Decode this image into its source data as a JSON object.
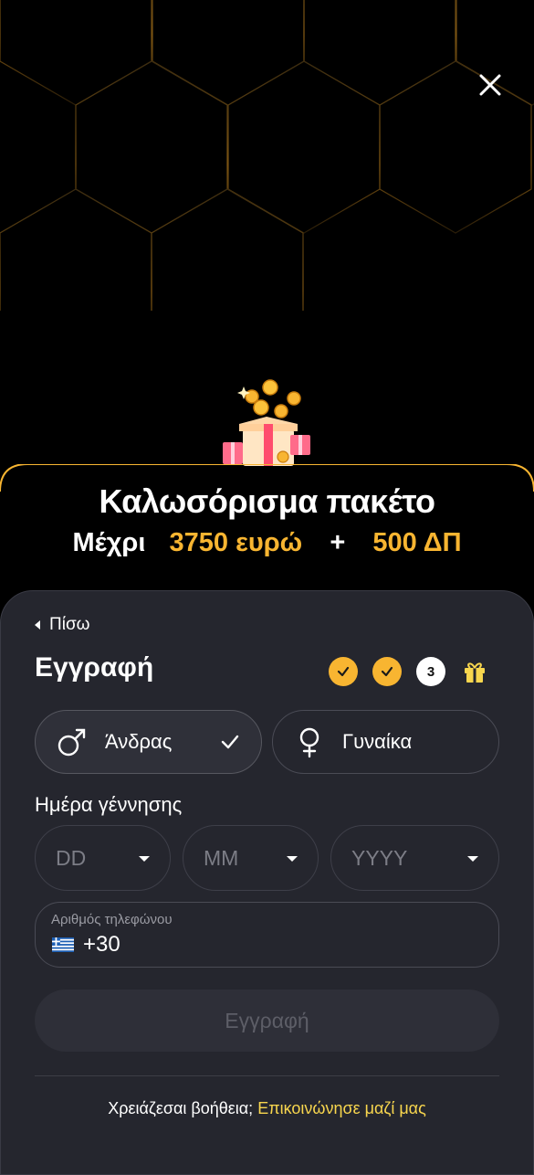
{
  "close": {
    "icon": "close-icon"
  },
  "promo": {
    "title": "Καλωσόρισμα πακέτο",
    "prefix": "Μέχρι",
    "amount": "3750 ευρώ",
    "plus": "+",
    "bonus": "500 ΔΠ"
  },
  "form": {
    "back_label": "Πίσω",
    "title": "Εγγραφή",
    "steps": [
      {
        "state": "done",
        "icon": "check-icon"
      },
      {
        "state": "done",
        "icon": "check-icon"
      },
      {
        "state": "current",
        "label": "3"
      },
      {
        "state": "reward",
        "icon": "gift-icon"
      }
    ],
    "gender": {
      "male_label": "Άνδρας",
      "female_label": "Γυναίκα",
      "selected": "male"
    },
    "dob": {
      "label": "Ημέρα γέννησης",
      "day_placeholder": "DD",
      "month_placeholder": "MM",
      "year_placeholder": "YYYY"
    },
    "phone": {
      "label": "Αριθμός τηλεφώνου",
      "country_icon": "greece-flag-icon",
      "code": "+30"
    },
    "submit_label": "Εγγραφή"
  },
  "help": {
    "text": "Χρειάζεσαι βοήθεια;",
    "link": "Επικοινώνησε μαζί μας"
  },
  "colors": {
    "accent": "#f8b531",
    "link": "#f8d64e",
    "panel": "#25262e",
    "background": "#000000"
  }
}
